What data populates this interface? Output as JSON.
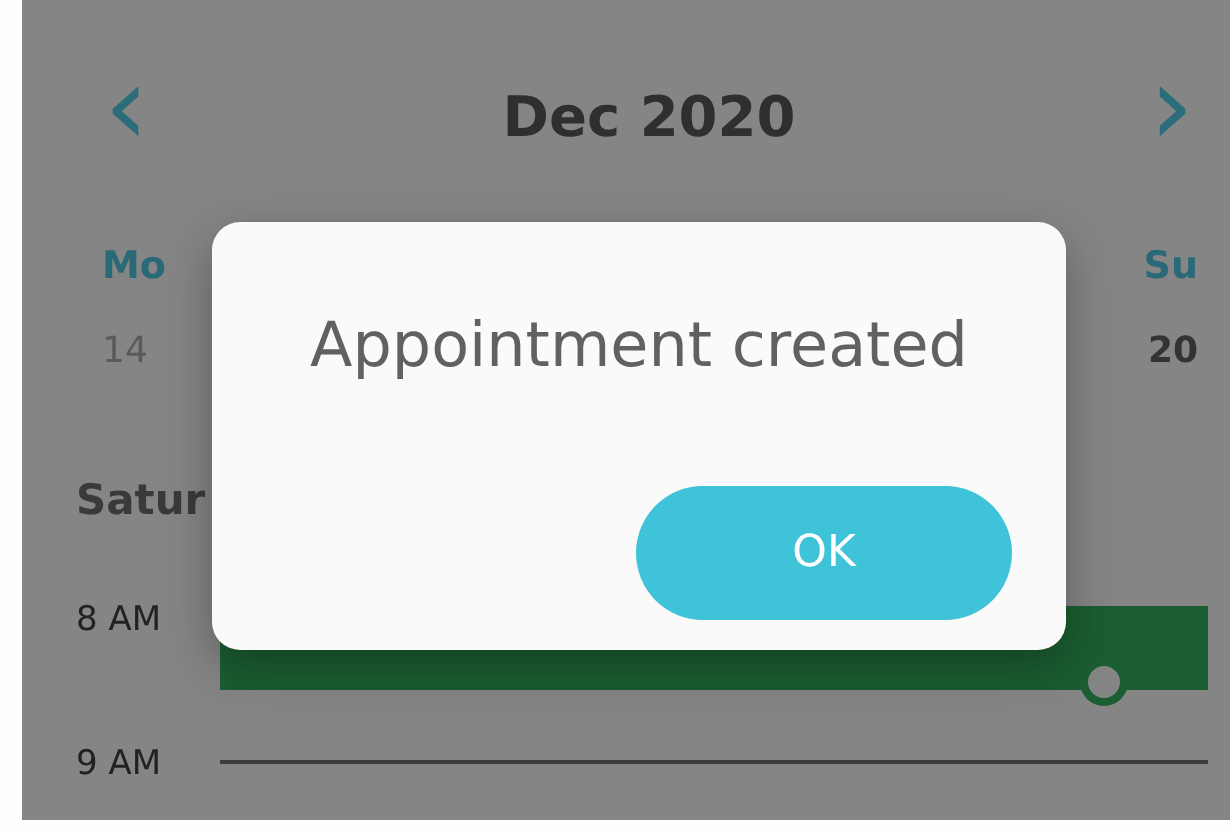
{
  "header": {
    "prev": "‹",
    "title": "Dec 2020",
    "next": "›"
  },
  "days": [
    {
      "weekday": "Mo",
      "date": "14",
      "disabled": true
    },
    {
      "weekday": "Su",
      "date": "20",
      "disabled": false
    }
  ],
  "day_heading": "Satur",
  "schedule": [
    {
      "time": "8 AM",
      "kind": "event"
    },
    {
      "time": "9 AM",
      "kind": "line"
    }
  ],
  "dialog": {
    "message": "Appointment created",
    "button": "OK"
  }
}
